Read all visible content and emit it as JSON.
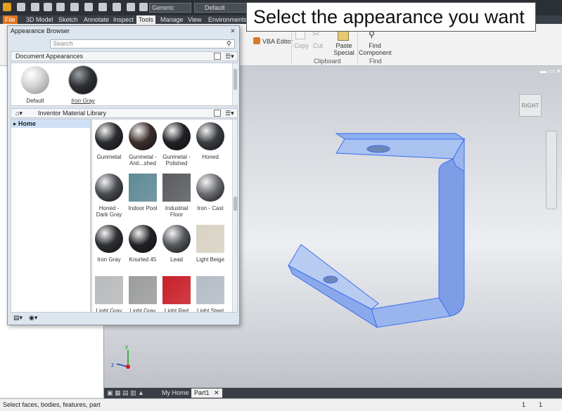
{
  "callout": {
    "text": "Select the appearance you want"
  },
  "qat": {
    "material_combo": "Generic",
    "appearance_combo": "Default"
  },
  "ribbon": {
    "tabs": [
      "File",
      "3D Model",
      "Sketch",
      "Annotate",
      "Inspect",
      "Tools",
      "Manage",
      "View",
      "Environments"
    ],
    "vba_editor": "VBA Editor",
    "copy": "Copy",
    "cut": "Cut",
    "paste_special_1": "Paste",
    "paste_special_2": "Special",
    "find_component_1": "Find",
    "find_component_2": "Component",
    "group_clipboard": "Clipboard",
    "group_find": "Find"
  },
  "appearance_browser": {
    "title": "Appearance Browser",
    "search_placeholder": "Search",
    "doc_section": "Document Appearances",
    "doc_items": [
      {
        "label": "Default"
      },
      {
        "label": "Iron Gray"
      }
    ],
    "library": "Inventor Material Library",
    "tree_home": "Home",
    "swatches": [
      {
        "l1": "Gunmetal",
        "l2": "",
        "color": "#2a2c30"
      },
      {
        "l1": "Gunmetal -",
        "l2": "Anti...shed",
        "color": "#3b2e2a"
      },
      {
        "l1": "Gunmetal -",
        "l2": "Polished",
        "color": "#1f2124"
      },
      {
        "l1": "Honed",
        "l2": "",
        "color": "#3a3d42"
      },
      {
        "l1": "Honed -",
        "l2": "Dark Gray",
        "color": "#4a4d52"
      },
      {
        "l1": "Indoor Pool",
        "l2": "",
        "color": "#5e8a96"
      },
      {
        "l1": "Industrial",
        "l2": "Floor",
        "color": "#5a5c60"
      },
      {
        "l1": "Iron - Cast",
        "l2": "",
        "color": "#6c6e72"
      },
      {
        "l1": "Iron Gray",
        "l2": "",
        "color": "#2e3034"
      },
      {
        "l1": "Knurled 45",
        "l2": "",
        "color": "#202226"
      },
      {
        "l1": "Lead",
        "l2": "",
        "color": "#55585d"
      },
      {
        "l1": "Light Beige",
        "l2": "",
        "color": "#d8d2c2"
      },
      {
        "l1": "Light Gray",
        "l2": "",
        "color": "#b8babc"
      },
      {
        "l1": "Light Gray",
        "l2": "",
        "color": "#9a9c9e"
      },
      {
        "l1": "Light Red",
        "l2": "",
        "color": "#c8202a"
      },
      {
        "l1": "Light Steel",
        "l2": "",
        "color": "#b4bcc6"
      }
    ]
  },
  "viewcube": {
    "face": "RIGHT"
  },
  "viewport_tabs": {
    "home": "My Home",
    "part": "Part1"
  },
  "status": {
    "text": "Select faces, bodies, features, part",
    "n1": "1",
    "n2": "1"
  },
  "colors": {
    "file_tab": "#e0741c",
    "selection_blue": "#3a6ef0"
  }
}
